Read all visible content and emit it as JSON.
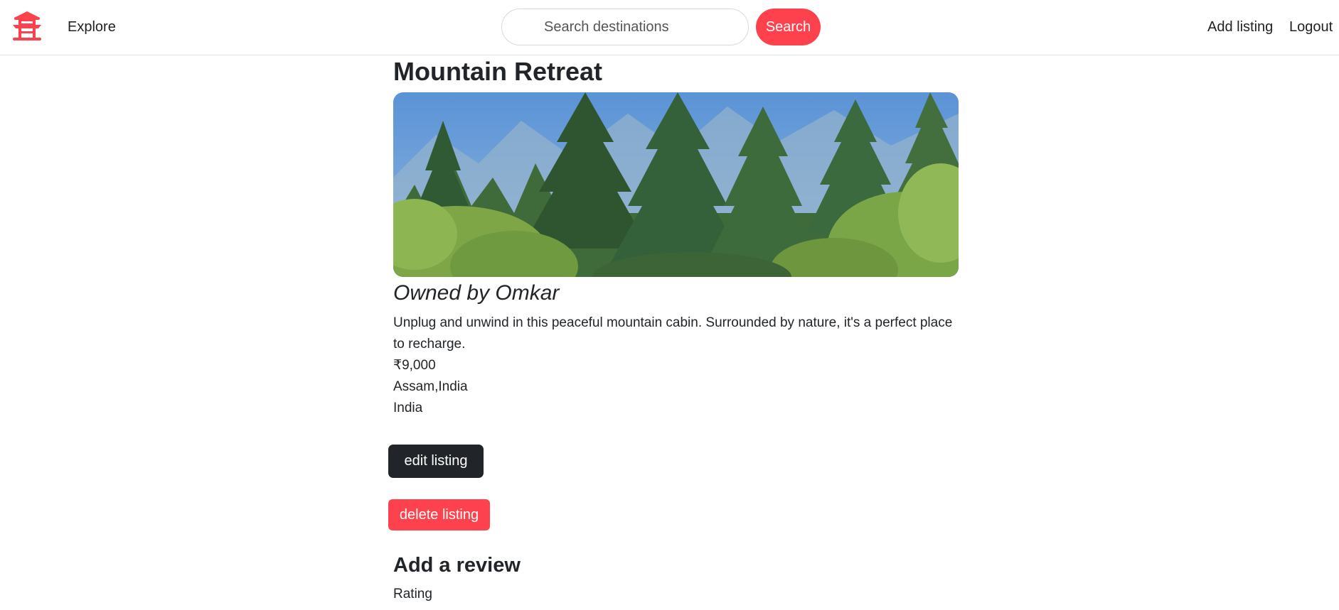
{
  "navbar": {
    "logo_icon": "pagoda-icon",
    "explore_label": "Explore",
    "search_placeholder": "Search destinations",
    "search_value": "",
    "search_button_label": "Search",
    "add_listing_label": "Add listing",
    "logout_label": "Logout"
  },
  "listing": {
    "title": "Mountain Retreat",
    "owner": "Owned by Omkar",
    "description": "Unplug and unwind in this peaceful mountain cabin. Surrounded by nature, it's a perfect place to recharge.",
    "price": "₹9,000",
    "location": "Assam,India",
    "country": "India",
    "edit_label": "edit listing",
    "delete_label": "delete listing"
  },
  "review": {
    "heading": "Add a review",
    "rating_label": "Rating"
  },
  "colors": {
    "brand": "#fe424d",
    "dark_button": "#212529"
  }
}
